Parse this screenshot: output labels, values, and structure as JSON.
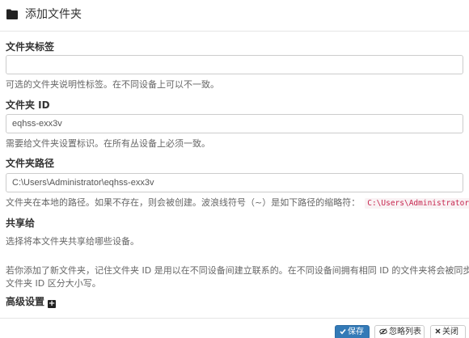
{
  "header": {
    "title": "添加文件夹"
  },
  "folder_label": {
    "label": "文件夹标签",
    "value": "",
    "help": "可选的文件夹说明性标签。在不同设备上可以不一致。"
  },
  "folder_id": {
    "label": "文件夹 ID",
    "value": "eqhss-exx3v",
    "help": "需要给文件夹设置标识。在所有丛设备上必须一致。"
  },
  "folder_path": {
    "label": "文件夹路径",
    "value": "C:\\Users\\Administrator\\eqhss-exx3v",
    "help": "文件夹在本地的路径。如果不存在，则会被创建。波浪线符号（~）是如下路径的缩略符：",
    "help_code": "C:\\Users\\Administrator"
  },
  "share": {
    "label": "共享给",
    "help": "选择将本文件夹共享给哪些设备。"
  },
  "notice": {
    "line1": "若你添加了新文件夹，记住文件夹 ID 是用以在不同设备间建立联系的。在不同设备间拥有相同 ID 的文件夹将会被同步。且",
    "line2": "文件夹 ID 区分大小写。"
  },
  "advanced": {
    "label": "高级设置",
    "icon": "plus-square-icon"
  },
  "footer": {
    "save_label": "保存",
    "ignore_label": "忽略列表",
    "close_label": "关闭"
  },
  "colors": {
    "primary": "#337ab7",
    "code": "#c7254e"
  }
}
